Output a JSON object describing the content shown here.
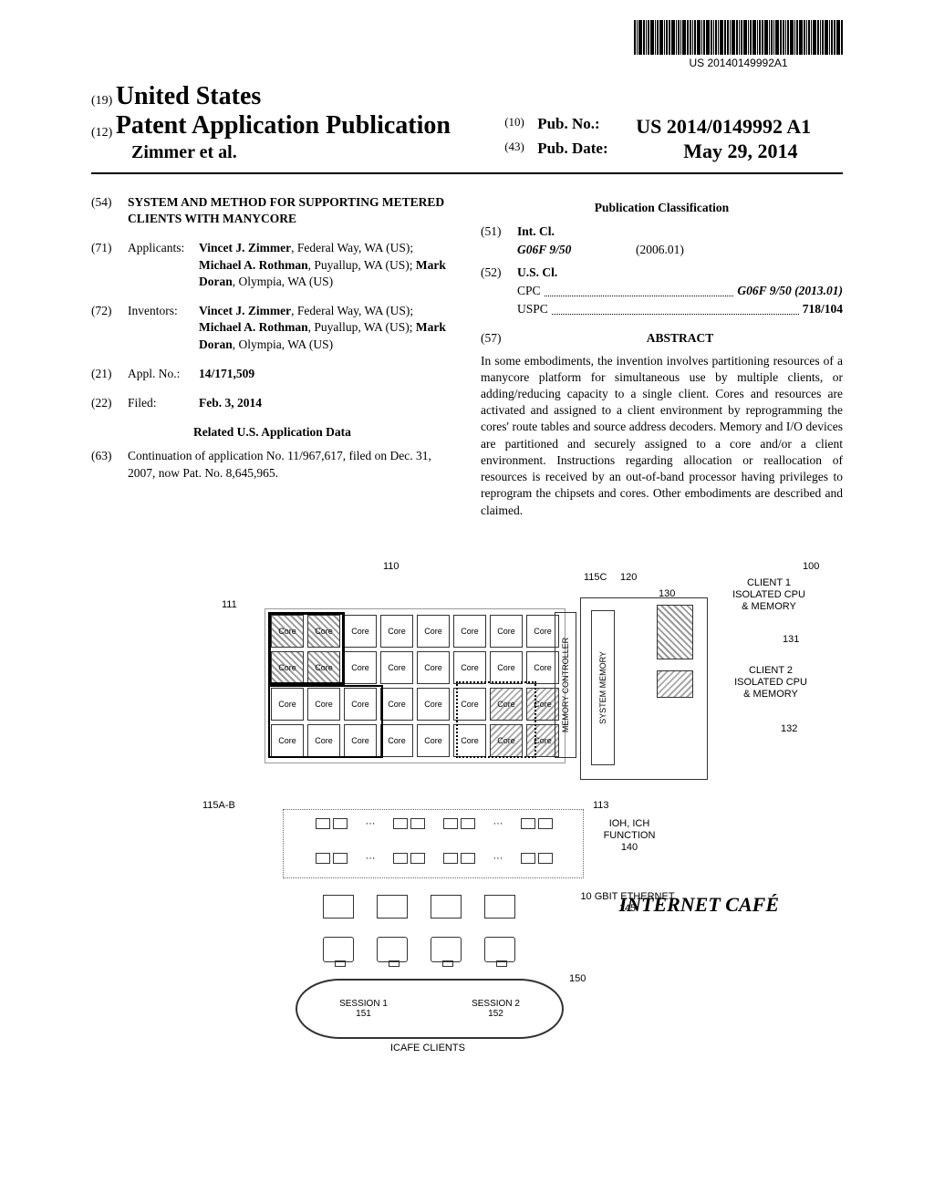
{
  "barcode_text": "US 20140149992A1",
  "header": {
    "code19": "(19)",
    "country": "United States",
    "code12": "(12)",
    "pub_title": "Patent Application Publication",
    "authors": "Zimmer et al.",
    "code10": "(10)",
    "pubno_label": "Pub. No.:",
    "pubno": "US 2014/0149992 A1",
    "code43": "(43)",
    "pubdate_label": "Pub. Date:",
    "pubdate": "May 29, 2014"
  },
  "left": {
    "c54": "(54)",
    "title": "SYSTEM AND METHOD FOR SUPPORTING METERED CLIENTS WITH MANYCORE",
    "c71": "(71)",
    "l71": "Applicants:",
    "applicants": "Vincet J. Zimmer, Federal Way, WA (US); Michael A. Rothman, Puyallup, WA (US); Mark Doran, Olympia, WA (US)",
    "applicants_bold": [
      "Vincet J. Zimmer",
      "Michael A. Rothman",
      "Mark Doran"
    ],
    "c72": "(72)",
    "l72": "Inventors:",
    "inventors": "Vincet J. Zimmer, Federal Way, WA (US); Michael A. Rothman, Puyallup, WA (US); Mark Doran, Olympia, WA (US)",
    "c21": "(21)",
    "l21": "Appl. No.:",
    "applno": "14/171,509",
    "c22": "(22)",
    "l22": "Filed:",
    "filed": "Feb. 3, 2014",
    "related_head": "Related U.S. Application Data",
    "c63": "(63)",
    "related": "Continuation of application No. 11/967,617, filed on Dec. 31, 2007, now Pat. No. 8,645,965."
  },
  "right": {
    "pubclass_head": "Publication Classification",
    "c51": "(51)",
    "intcl_label": "Int. Cl.",
    "intcl_code": "G06F 9/50",
    "intcl_ver": "(2006.01)",
    "c52": "(52)",
    "uscl_label": "U.S. Cl.",
    "cpc_label": "CPC",
    "cpc_val": "G06F 9/50 (2013.01)",
    "uspc_label": "USPC",
    "uspc_val": "718/104",
    "c57": "(57)",
    "abstract_head": "ABSTRACT",
    "abstract": "In some embodiments, the invention involves partitioning resources of a manycore platform for simultaneous use by multiple clients, or adding/reducing capacity to a single client. Cores and resources are activated and assigned to a client environment by reprogramming the cores' route tables and source address decoders. Memory and I/O devices are partitioned and securely assigned to a core and/or a client environment. Instructions regarding allocation or reallocation of resources is received by an out-of-band processor having privileges to reprogram the chipsets and cores. Other embodiments are described and claimed."
  },
  "figure": {
    "ref_100": "100",
    "ref_110": "110",
    "ref_111": "111",
    "ref_113": "113",
    "ref_115ab": "115A-B",
    "ref_115c": "115C",
    "ref_120": "120",
    "ref_130": "130",
    "ref_131": "131",
    "ref_132": "132",
    "ref_140": "140",
    "ref_145": "145",
    "ref_150": "150",
    "ref_151": "151",
    "ref_152": "152",
    "core": "Core",
    "mem_controller": "MEMORY CONTROLLER",
    "sys_memory": "SYSTEM MEMORY",
    "client1": "CLIENT 1 ISOLATED CPU & MEMORY",
    "client2": "CLIENT 2 ISOLATED CPU & MEMORY",
    "ioh": "IOH, ICH FUNCTION",
    "eth": "10 GBIT ETHERNET",
    "session1": "SESSION 1",
    "session2": "SESSION 2",
    "icafe": "ICAFE CLIENTS",
    "internet_cafe": "INTERNET CAFÉ"
  }
}
